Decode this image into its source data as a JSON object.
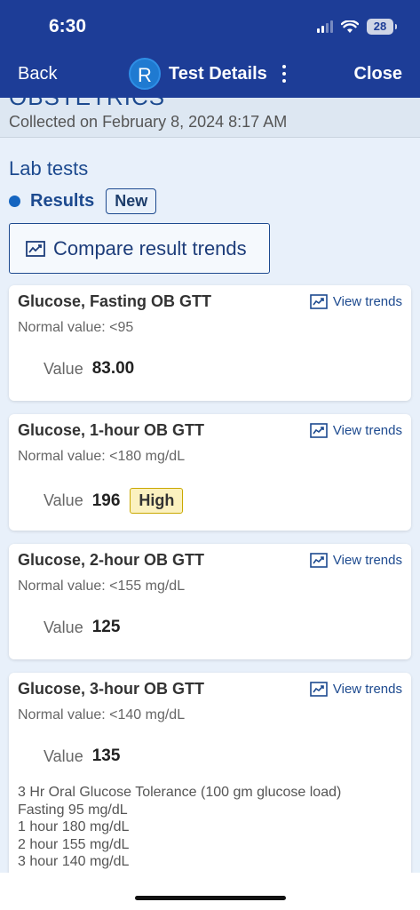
{
  "status_bar": {
    "time": "6:30",
    "battery": "28"
  },
  "nav": {
    "back_label": "Back",
    "avatar_letter": "R",
    "title": "Test Details",
    "close_label": "Close"
  },
  "header": {
    "section_title": "OBSTETRICS",
    "collected": "Collected on February 8, 2024 8:17 AM"
  },
  "lab_tests_heading": "Lab tests",
  "results": {
    "label": "Results",
    "badge": "New"
  },
  "compare_button": "Compare result trends",
  "value_label": "Value",
  "trends_label": "View trends",
  "cards": [
    {
      "name": "Glucose, Fasting OB GTT",
      "normal": "Normal value: <95",
      "value": "83.00",
      "flag": ""
    },
    {
      "name": "Glucose, 1-hour OB GTT",
      "normal": "Normal value: <180 mg/dL",
      "value": "196",
      "flag": "High"
    },
    {
      "name": "Glucose, 2-hour OB GTT",
      "normal": "Normal value: <155 mg/dL",
      "value": "125",
      "flag": ""
    },
    {
      "name": "Glucose, 3-hour OB GTT",
      "normal": "Normal value: <140 mg/dL",
      "value": "135",
      "flag": "",
      "note": [
        "3 Hr Oral Glucose Tolerance (100 gm glucose load)",
        "Fasting 95 mg/dL",
        "1 hour 180 mg/dL",
        "2 hour 155 mg/dL",
        "3 hour 140 mg/dL"
      ]
    }
  ],
  "colors": {
    "nav_bg": "#1d3d97",
    "accent": "#1d4a8f",
    "high_bg": "#fbf1bf",
    "page_bg": "#e8f0fa"
  }
}
